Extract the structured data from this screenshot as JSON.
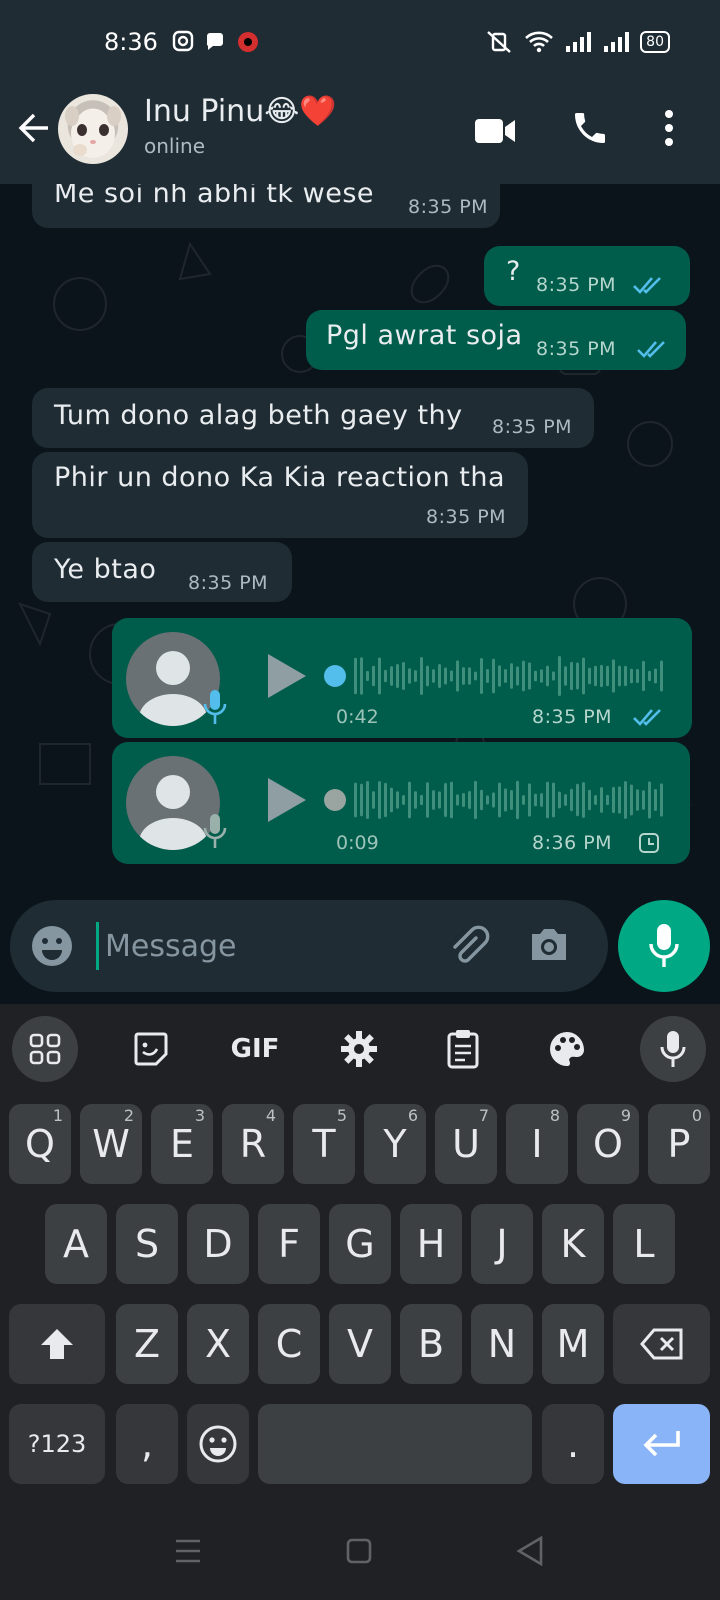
{
  "status_bar": {
    "time": "8:36",
    "battery": "80"
  },
  "header": {
    "contact_name": "Inu Pinu😂❤️",
    "status": "online"
  },
  "messages": [
    {
      "dir": "in",
      "text": "Me soi nh abhi tk wese",
      "time": "8:35 PM"
    },
    {
      "dir": "out",
      "text": "?",
      "time": "8:35 PM"
    },
    {
      "dir": "out",
      "text": "Pgl awrat soja",
      "time": "8:35 PM"
    },
    {
      "dir": "in",
      "text": "Tum dono alag beth gaey thy",
      "time": "8:35 PM"
    },
    {
      "dir": "in",
      "text": "Phir un dono Ka Kia reaction tha",
      "time": "8:35 PM"
    },
    {
      "dir": "in",
      "text": "Ye btao",
      "time": "8:35 PM"
    }
  ],
  "voice_notes": [
    {
      "duration": "0:42",
      "time": "8:35 PM",
      "status": "read"
    },
    {
      "duration": "0:09",
      "time": "8:36 PM",
      "status": "pending"
    }
  ],
  "composer": {
    "placeholder": "Message"
  },
  "keyboard": {
    "toolbar_gif": "GIF",
    "row1": [
      {
        "k": "Q",
        "h": "1"
      },
      {
        "k": "W",
        "h": "2"
      },
      {
        "k": "E",
        "h": "3"
      },
      {
        "k": "R",
        "h": "4"
      },
      {
        "k": "T",
        "h": "5"
      },
      {
        "k": "Y",
        "h": "6"
      },
      {
        "k": "U",
        "h": "7"
      },
      {
        "k": "I",
        "h": "8"
      },
      {
        "k": "O",
        "h": "9"
      },
      {
        "k": "P",
        "h": "0"
      }
    ],
    "row2": [
      "A",
      "S",
      "D",
      "F",
      "G",
      "H",
      "J",
      "K",
      "L"
    ],
    "row3": [
      "Z",
      "X",
      "C",
      "V",
      "B",
      "N",
      "M"
    ],
    "sym_label": "?123",
    "comma": ",",
    "period": "."
  },
  "colors": {
    "incoming": "#1f2c34",
    "outgoing": "#005c4b",
    "accent": "#00a884",
    "read_ticks": "#53bdeb"
  }
}
